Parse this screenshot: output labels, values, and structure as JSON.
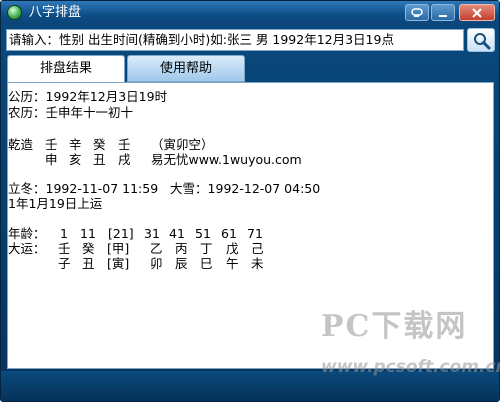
{
  "window": {
    "title": "八字排盘",
    "controls": {
      "minimize": "minimize",
      "restore": "restore",
      "close": "close"
    }
  },
  "input": {
    "value": "请输入：性别 出生时间(精确到小时)如:张三 男 1992年12月3日19点"
  },
  "tabs": [
    {
      "label": "排盘结果",
      "active": true
    },
    {
      "label": "使用帮助",
      "active": false
    }
  ],
  "result": {
    "solar": "公历：1992年12月3日19时",
    "lunar": "农历：壬申年十一初十",
    "qianzao_label": "乾造",
    "stems": [
      "壬",
      "辛",
      "癸",
      "壬"
    ],
    "void": "（寅卯空）",
    "branches": [
      "申",
      "亥",
      "丑",
      "戌"
    ],
    "site": "易无忧www.1wuyou.com",
    "jieqi": "立冬：1992-11-07 11:59   大雪：1992-12-07 04:50",
    "start_luck": "1年1月19日上运",
    "age_label": "年龄：",
    "ages": [
      "1",
      "11",
      "[21]",
      "31",
      "41",
      "51",
      "61",
      "71"
    ],
    "dayun_label": "大运：",
    "dayun_stems": [
      "壬",
      "癸",
      "[甲]",
      "乙",
      "丙",
      "丁",
      "戊",
      "己"
    ],
    "dayun_branches": [
      "子",
      "丑",
      "[寅]",
      "卯",
      "辰",
      "巳",
      "午",
      "未"
    ]
  },
  "watermark": {
    "main": "PC下载网",
    "sub": "www.pcsoft.com.cn"
  },
  "colors": {
    "frame": "#0a4a7e",
    "title_text": "#ffffff",
    "tab_inactive": "#9fc8ea"
  }
}
